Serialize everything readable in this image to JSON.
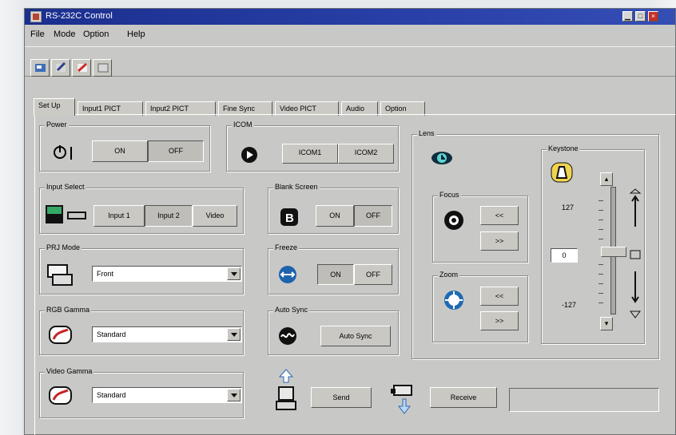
{
  "window": {
    "title": "RS-232C Control",
    "buttons": [
      "▁",
      "□",
      "×"
    ]
  },
  "menu": [
    "File",
    "Mode",
    "Option",
    "Help"
  ],
  "tabs": [
    "Set Up",
    "Input1 PICT",
    "Input2 PICT",
    "Fine Sync",
    "Video PICT",
    "Audio",
    "Option"
  ],
  "groups": {
    "power": {
      "label": "Power",
      "on": "ON",
      "off": "OFF"
    },
    "icom": {
      "label": "ICOM",
      "icom1": "ICOM1",
      "icom2": "ICOM2"
    },
    "input_select": {
      "label": "Input Select",
      "input1": "Input 1",
      "input2": "Input 2",
      "video": "Video"
    },
    "blank_screen": {
      "label": "Blank Screen",
      "on": "ON",
      "off": "OFF"
    },
    "prj_mode": {
      "label": "PRJ Mode",
      "value": "Front"
    },
    "freeze": {
      "label": "Freeze",
      "on": "ON",
      "off": "OFF"
    },
    "rgb_gamma": {
      "label": "RGB Gamma",
      "value": "Standard"
    },
    "auto_sync": {
      "label": "Auto Sync",
      "button": "Auto Sync"
    },
    "video_gamma": {
      "label": "Video Gamma",
      "value": "Standard"
    },
    "lens": {
      "label": "Lens"
    },
    "focus": {
      "label": "Focus",
      "btn1": "<<",
      "btn2": ">>"
    },
    "zoom": {
      "label": "Zoom",
      "btn1": "<<",
      "btn2": ">>"
    },
    "keystone": {
      "label": "Keystone",
      "top": "127",
      "value": "0",
      "bottom": "-127",
      "level": 0
    }
  },
  "actions": {
    "send": "Send",
    "receive": "Receive"
  },
  "icons": [
    "power-icon",
    "icom-icon",
    "input-select-icon",
    "blank-screen-icon",
    "prj-mode-icon",
    "freeze-icon",
    "gamma-icon",
    "auto-sync-icon",
    "lens-icon",
    "focus-icon",
    "zoom-icon",
    "keystone-icon",
    "send-icon",
    "receive-icon"
  ]
}
